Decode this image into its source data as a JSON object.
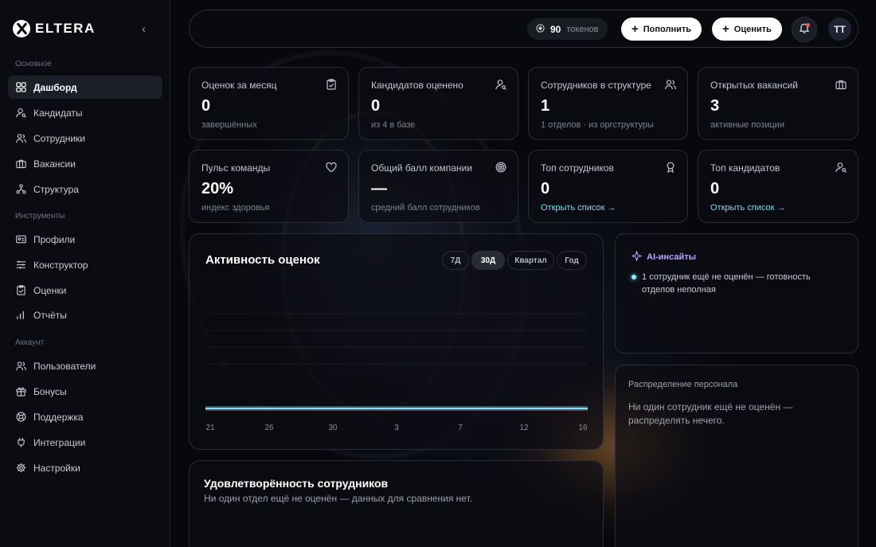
{
  "sidebar": {
    "logo": "ELTERA",
    "sections": {
      "main": "Основное",
      "tools": "Инструменты",
      "account": "Аккаунт"
    },
    "items": [
      {
        "label": "Дашборд",
        "icon": "dashboard-icon",
        "active": true
      },
      {
        "label": "Кандидаты",
        "icon": "candidate-icon"
      },
      {
        "label": "Сотрудники",
        "icon": "employees-icon"
      },
      {
        "label": "Вакансии",
        "icon": "briefcase-icon"
      },
      {
        "label": "Структура",
        "icon": "structure-icon"
      },
      {
        "label": "Профили",
        "icon": "profile-card-icon"
      },
      {
        "label": "Конструктор",
        "icon": "sliders-icon"
      },
      {
        "label": "Оценки",
        "icon": "clipboard-icon"
      },
      {
        "label": "Отчёты",
        "icon": "bar-chart-icon"
      },
      {
        "label": "Пользователи",
        "icon": "users-icon"
      },
      {
        "label": "Бонусы",
        "icon": "gift-icon"
      },
      {
        "label": "Поддержка",
        "icon": "lifebuoy-icon"
      },
      {
        "label": "Интеграции",
        "icon": "plug-icon"
      },
      {
        "label": "Настройки",
        "icon": "gear-icon"
      }
    ]
  },
  "topbar": {
    "tokens_value": "90",
    "tokens_label": "токенов",
    "topup_label": "Пополнить",
    "evaluate_label": "Оценить",
    "avatar_initials": "TT"
  },
  "stats": [
    {
      "title": "Оценок за месяц",
      "value": "0",
      "sub": "завершённых",
      "icon": "clipboard-check-icon"
    },
    {
      "title": "Кандидатов оценено",
      "value": "0",
      "sub": "из 4 в базе",
      "icon": "user-search-icon"
    },
    {
      "title": "Сотрудников в структуре",
      "value": "1",
      "sub": "1 отделов · из оргструктуры",
      "icon": "users-icon"
    },
    {
      "title": "Открытых вакансий",
      "value": "3",
      "sub": "активные позиции",
      "icon": "briefcase-icon"
    },
    {
      "title": "Пульс команды",
      "value": "20%",
      "sub": "индекс здоровья",
      "icon": "heart-icon"
    },
    {
      "title": "Общий балл компании",
      "value": "—",
      "sub": "средний балл сотрудников",
      "icon": "target-icon"
    },
    {
      "title": "Топ сотрудников",
      "value": "0",
      "link": "Открыть список →",
      "icon": "award-icon"
    },
    {
      "title": "Топ кандидатов",
      "value": "0",
      "link": "Открыть список →",
      "icon": "user-search-icon"
    }
  ],
  "activity": {
    "title": "Активность оценок",
    "ranges": [
      "7Д",
      "30Д",
      "Квартал",
      "Год"
    ],
    "active_range": "30Д"
  },
  "chart_data": {
    "type": "line",
    "title": "Активность оценок",
    "categories": [
      "21",
      "26",
      "30",
      "3",
      "7",
      "12",
      "16"
    ],
    "series": [
      {
        "values": [
          0,
          0,
          0,
          0,
          0,
          0,
          0
        ]
      }
    ],
    "grid": true,
    "color": "#8fe0f5"
  },
  "insights": {
    "title": "AI-инсайты",
    "items": [
      "1 сотрудник ещё не оценён — готовность отделов неполная"
    ]
  },
  "distribution": {
    "title": "Распределение персонала",
    "text": "Ни один сотрудник ещё не оценён — распределять нечего."
  },
  "satisfaction": {
    "title": "Удовлетворённость сотрудников",
    "text": "Ни один отдел ещё не оценён — данных для сравнения нет."
  }
}
